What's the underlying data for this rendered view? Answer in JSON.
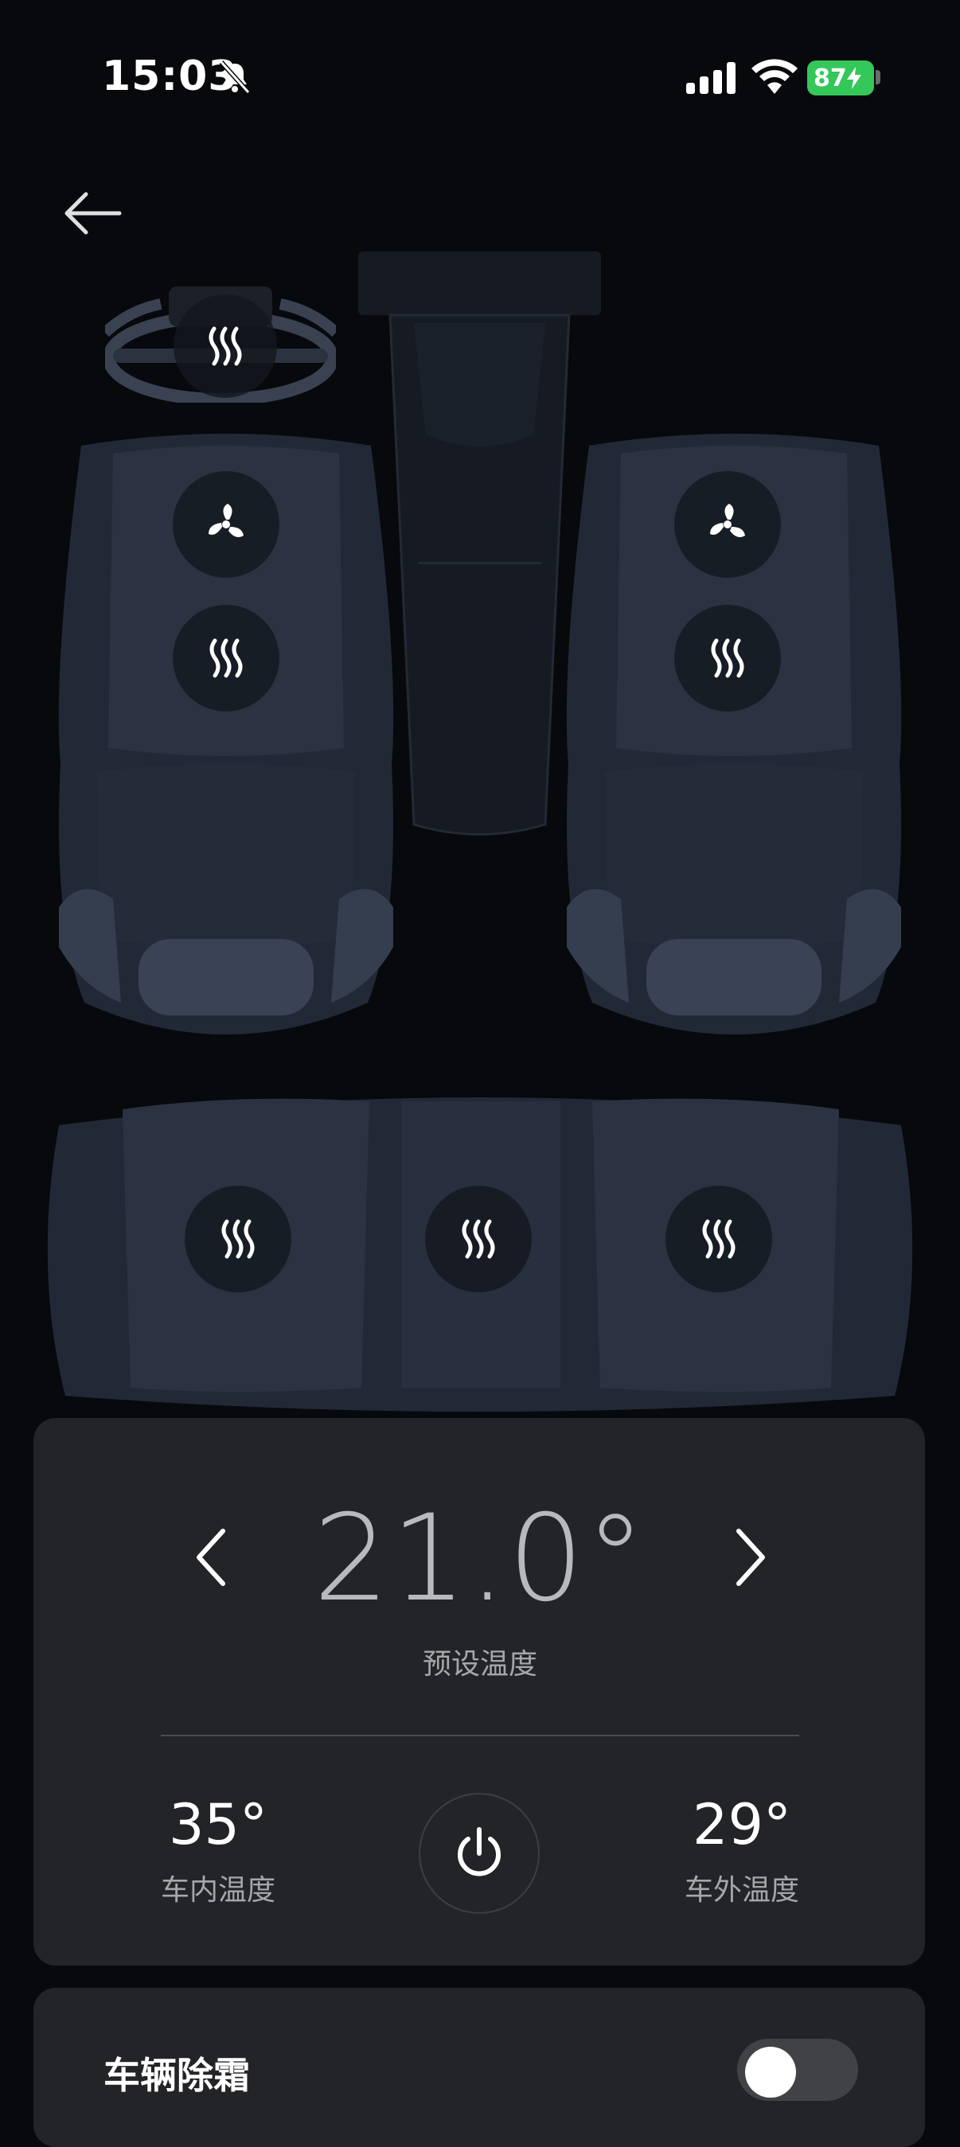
{
  "status_bar": {
    "time": "15:03",
    "battery_percent": "87",
    "icons": [
      "bell-slash-icon",
      "cellular-signal-icon",
      "wifi-icon",
      "battery-charging-icon"
    ]
  },
  "nav": {
    "back_icon": "arrow-left-icon"
  },
  "seats": {
    "steering_wheel": [
      "heat-icon"
    ],
    "front_left": [
      "fan-icon",
      "heat-icon"
    ],
    "front_right": [
      "fan-icon",
      "heat-icon"
    ],
    "rear": [
      "heat-icon",
      "heat-icon",
      "heat-icon"
    ]
  },
  "climate": {
    "preset_temp": "21.0°",
    "preset_label": "预设温度",
    "inside_temp": "35°",
    "inside_label": "车内温度",
    "outside_temp": "29°",
    "outside_label": "车外温度",
    "power_icon": "power-icon"
  },
  "defrost": {
    "label": "车辆除霜",
    "enabled": false
  },
  "colors": {
    "background": "#07090d",
    "card": "#232427",
    "battery": "#34c759",
    "seat": "#2b3342"
  }
}
